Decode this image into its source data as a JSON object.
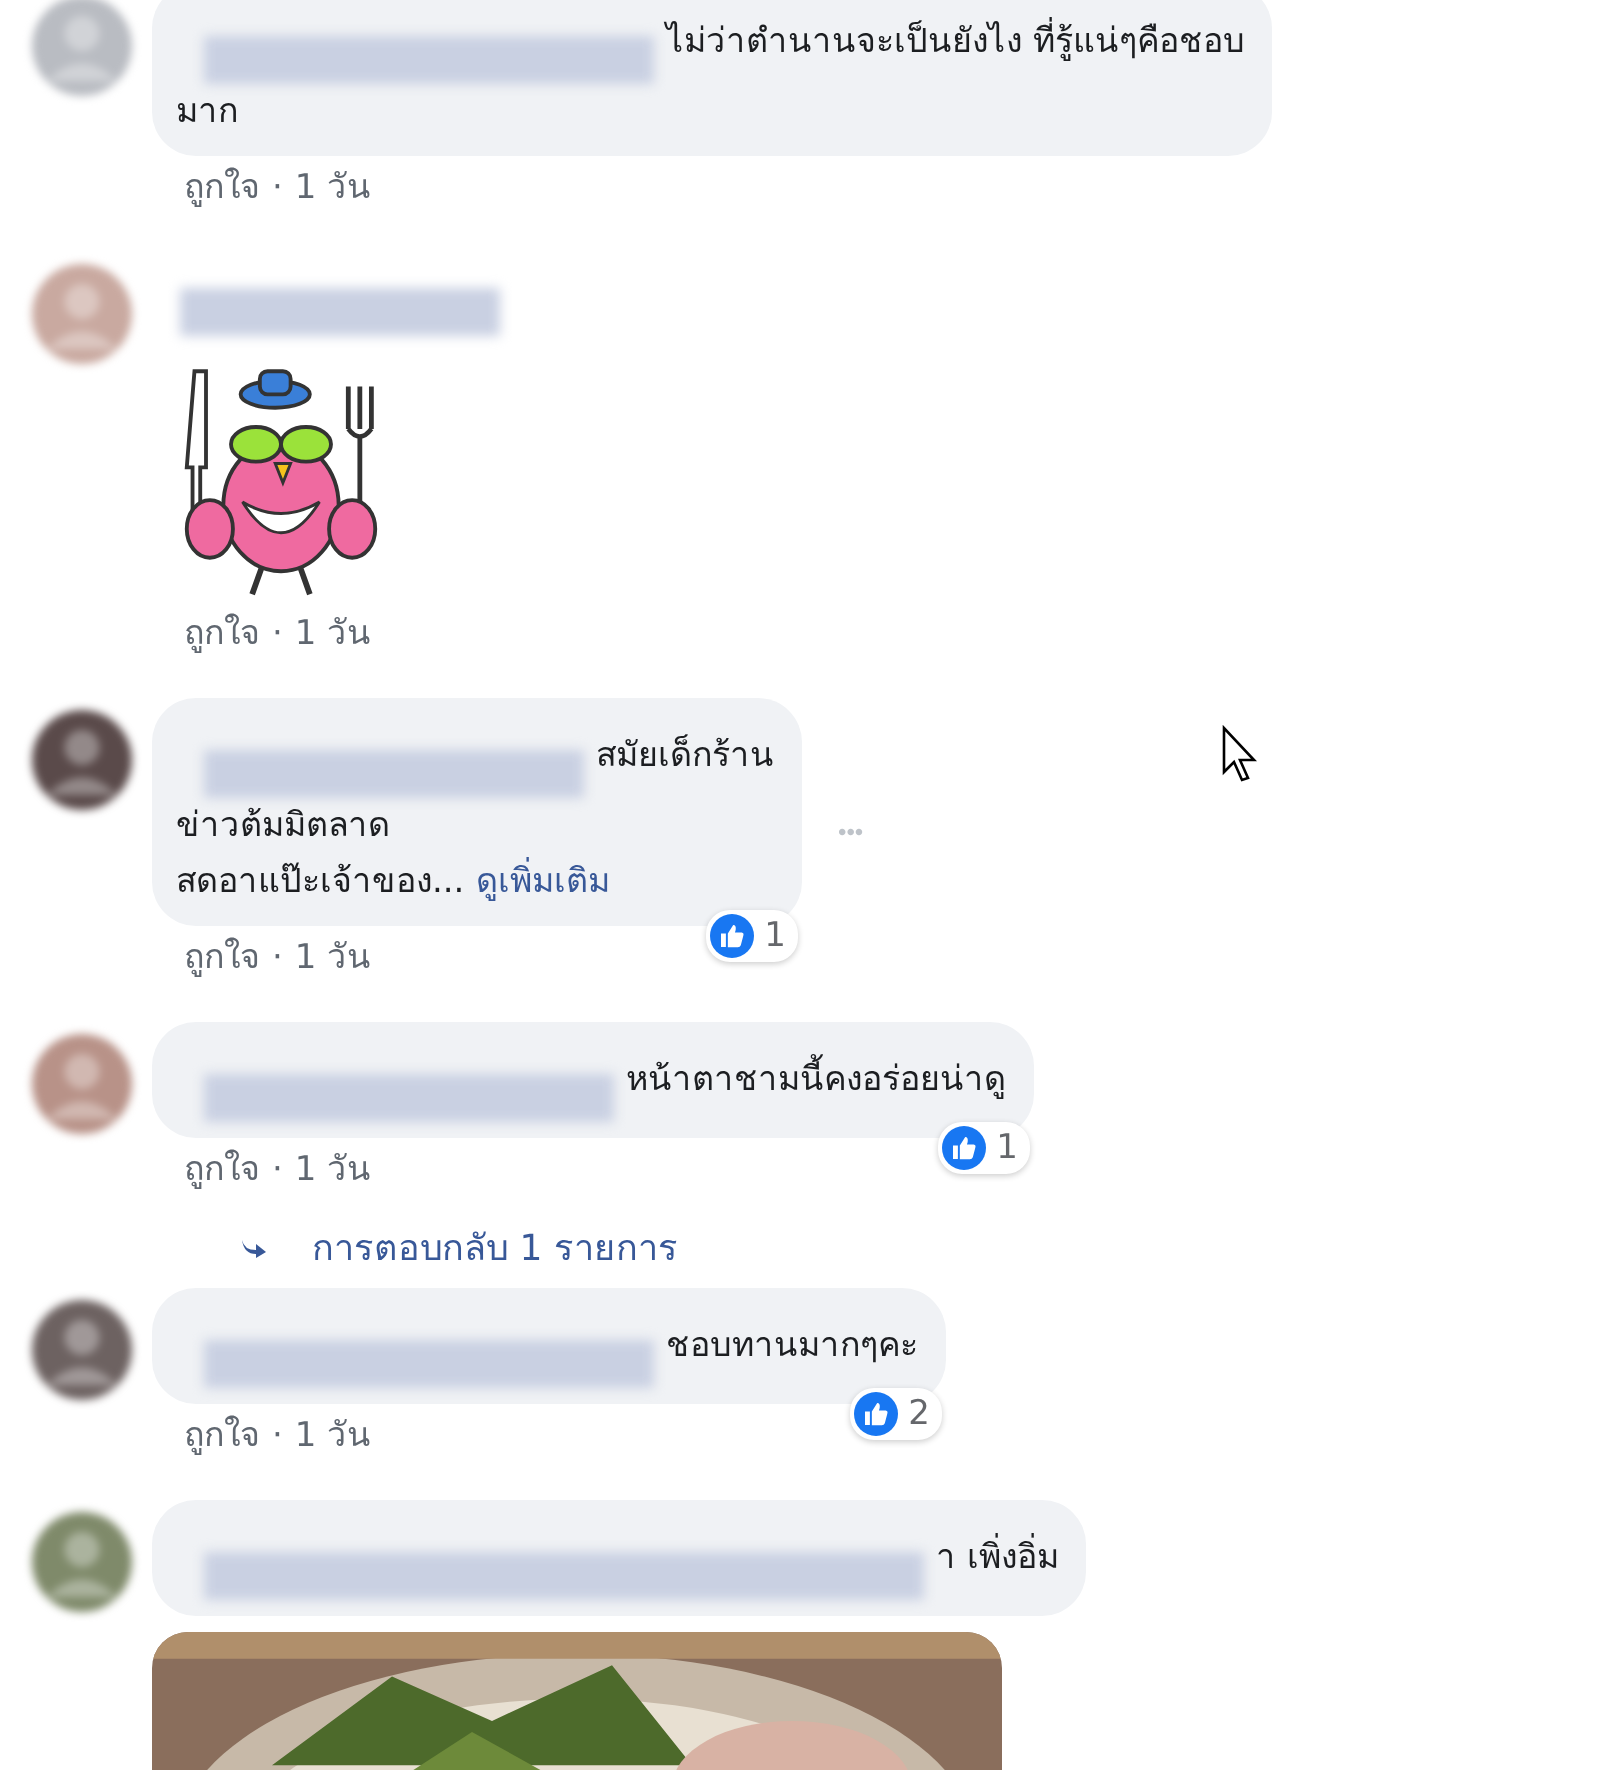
{
  "comments": [
    {
      "kind": "text",
      "lines": [
        "ไม่ว่าตำนานจะเป็นยังไง ที่รู้แน่ๆคือชอบ",
        "มาก"
      ],
      "like": "ถูกใจ",
      "separator": "·",
      "time": "1 วัน"
    },
    {
      "kind": "sticker",
      "like": "ถูกใจ",
      "separator": "·",
      "time": "1 วัน"
    },
    {
      "kind": "text",
      "lines": [
        "สมัยเด็กร้าน",
        "ข่าวต้มมิตลาด",
        "สดอาแป๊ะเจ้าของ..."
      ],
      "more": "ดูเพิ่มเติม",
      "options": "•••",
      "reactions": "1",
      "like": "ถูกใจ",
      "separator": "·",
      "time": "1 วัน"
    },
    {
      "kind": "text",
      "lines": [
        "หน้าตาชามนี้คงอร่อยน่าดู"
      ],
      "reactions": "1",
      "like": "ถูกใจ",
      "separator": "·",
      "time": "1 วัน",
      "replies": "การตอบกลับ 1 รายการ"
    },
    {
      "kind": "text",
      "lines": [
        "ชอบทานมากๆคะ"
      ],
      "reactions": "2",
      "like": "ถูกใจ",
      "separator": "·",
      "time": "1 วัน"
    },
    {
      "lines": [
        "า เพิ่งอิ่ม"
      ]
    }
  ]
}
